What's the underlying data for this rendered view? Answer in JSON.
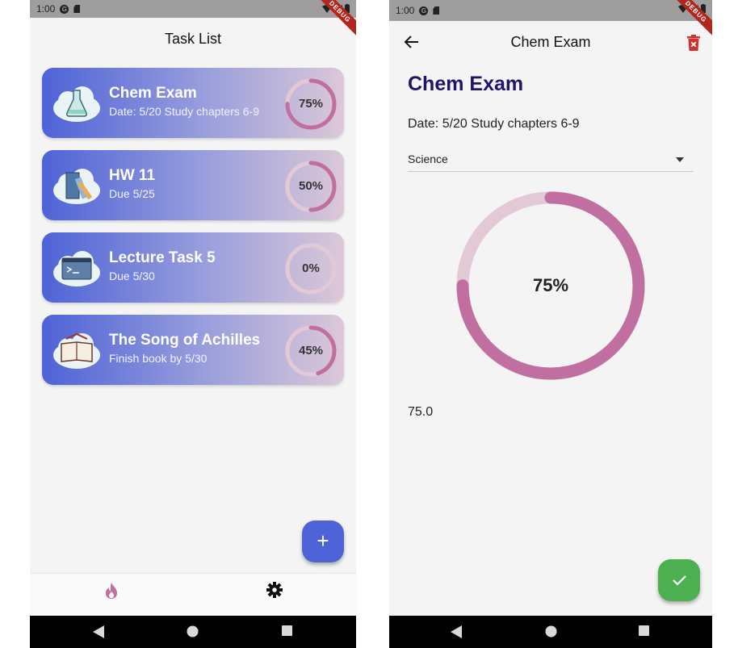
{
  "status_bar": {
    "time": "1:00",
    "debug_label": "DEBUG"
  },
  "task_list": {
    "title": "Task List",
    "tasks": [
      {
        "title": "Chem Exam",
        "subtitle": "Date: 5/20  Study chapters 6-9",
        "progress_label": "75%",
        "progress": 0.75,
        "icon": "flask-cloud-icon"
      },
      {
        "title": "HW 11",
        "subtitle": "Due 5/25",
        "progress_label": "50%",
        "progress": 0.5,
        "icon": "books-cloud-icon"
      },
      {
        "title": "Lecture Task 5",
        "subtitle": "Due 5/30",
        "progress_label": "0%",
        "progress": 0,
        "icon": "terminal-cloud-icon"
      },
      {
        "title": "The Song of Achilles",
        "subtitle": "Finish book by 5/30",
        "progress_label": "45%",
        "progress": 0.45,
        "icon": "book-cloud-icon"
      }
    ],
    "fab": "+",
    "bottom_nav": [
      {
        "icon": "fire-icon",
        "active": true
      },
      {
        "icon": "gear-icon",
        "active": false
      }
    ]
  },
  "detail": {
    "app_bar_title": "Chem Exam",
    "title": "Chem Exam",
    "description": "Date: 5/20  Study chapters 6-9",
    "category": "Science",
    "progress_label": "75%",
    "progress": 0.75,
    "value_text": "75.0"
  },
  "colors": {
    "card_start": "#4e63d7",
    "card_end": "#dcc8d8",
    "ring_fg": "#c06fa0",
    "ring_bg": "#e3c9d6",
    "fab_blue": "#4e63d7",
    "fab_green": "#4caf50",
    "title_navy": "#20136b",
    "delete_red": "#d32f2f"
  }
}
